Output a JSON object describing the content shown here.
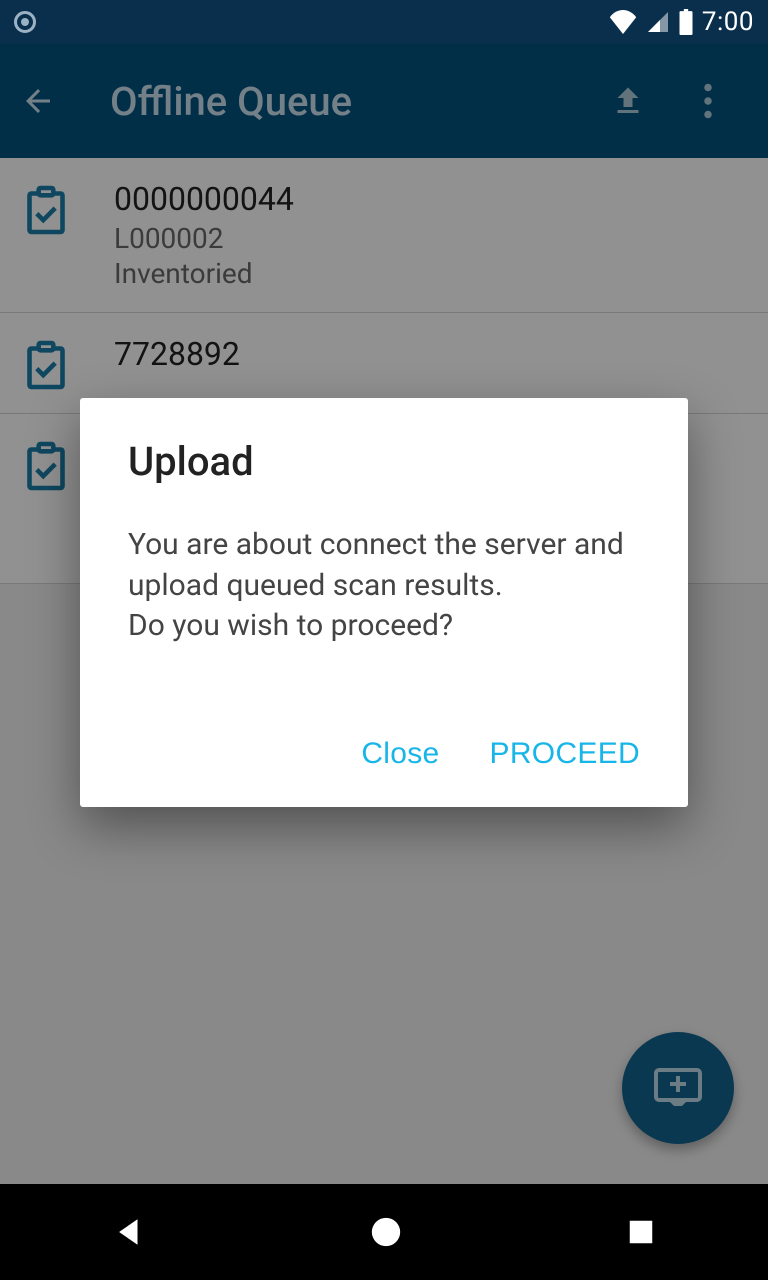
{
  "status": {
    "time": "7:00"
  },
  "appbar": {
    "title": "Offline Queue"
  },
  "items": [
    {
      "id": "0000000044",
      "loc": "L000002",
      "status": "Inventoried"
    },
    {
      "id": "7728892",
      "loc": "",
      "status": ""
    },
    {
      "id": "",
      "loc": "",
      "status": ""
    }
  ],
  "dialog": {
    "title": "Upload",
    "body": "You are about connect the server and upload queued scan results.\nDo you wish to proceed?",
    "close": "Close",
    "proceed": "PROCEED"
  }
}
